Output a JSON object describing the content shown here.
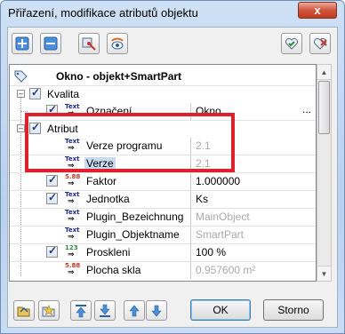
{
  "window": {
    "title": "Přiřazení, modifikace atributů objektu",
    "close_label": "x"
  },
  "tree": {
    "root": {
      "label": "Okno - objekt+SmartPart"
    },
    "groups": [
      {
        "label": "Kvalita",
        "items": [
          {
            "label": "Označení",
            "value": "Okno",
            "type": "Text",
            "has_dots": true
          }
        ]
      },
      {
        "label": "Atribut",
        "items": [
          {
            "label": "Verze programu",
            "value": "2.1",
            "type": "Text"
          },
          {
            "label": "Verze",
            "value": "2.1",
            "type": "Text",
            "selected": true
          },
          {
            "label": "Faktor",
            "value": "1.000000",
            "type": "5.88"
          },
          {
            "label": "Jednotka",
            "value": "Ks",
            "type": "Text"
          },
          {
            "label": "Plugin_Bezeichnung",
            "value": "MainObject",
            "type": "Text"
          },
          {
            "label": "Plugin_Objektname",
            "value": "SmartPart",
            "type": "Text"
          },
          {
            "label": "Proskleni",
            "value": "100 %",
            "type": "123"
          },
          {
            "label": "Plocha skla",
            "value": "0.957600 m²",
            "type": "5.88"
          }
        ]
      }
    ],
    "dots_label": "..."
  },
  "buttons": {
    "ok": "OK",
    "cancel": "Storno"
  },
  "icons": {
    "text_type": "Text",
    "accent_red": "#e0202c"
  }
}
